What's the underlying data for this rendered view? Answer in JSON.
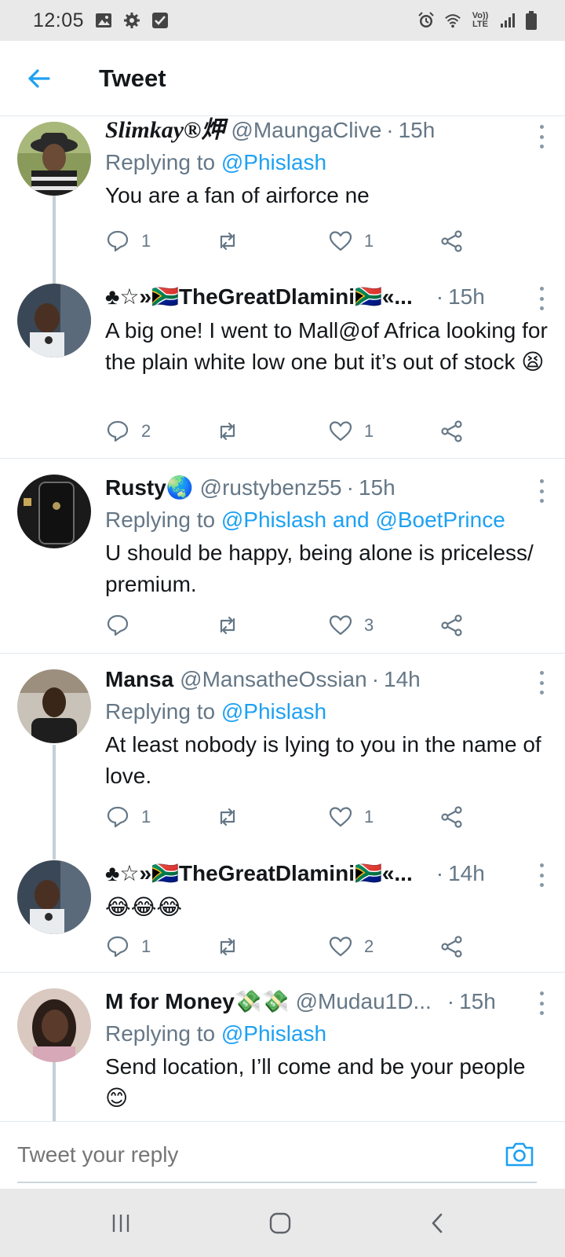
{
  "status_bar": {
    "time": "12:05",
    "left_icons": [
      "gallery-icon",
      "settings-icon",
      "checkbox-icon"
    ],
    "right_icons": [
      "alarm-icon",
      "wifi-icon",
      "volte-icon",
      "signal-icon",
      "battery-icon"
    ],
    "volte_text": "Vo)) LTE"
  },
  "header": {
    "title": "Tweet",
    "back_icon": "arrow-left-icon",
    "accent": "#1da1f2"
  },
  "tweets": [
    {
      "name": "Slimkay®炠",
      "handle": "@MaungaClive",
      "time": "15h",
      "replying_prefix": "Replying to ",
      "replying_to": "@Phislash",
      "text": "You are a fan of airforce ne",
      "reply_count": "1",
      "like_count": "1"
    },
    {
      "name": "♣☆»🇿🇦TheGreatDlamini🇿🇦«...",
      "handle": "",
      "time": "15h",
      "text": "A big one! I went to Mall@of Africa looking for the plain white low one but it’s out of stock 😫",
      "reply_count": "2",
      "like_count": "1"
    },
    {
      "name": "Rusty🌏",
      "handle": "@rustybenz55",
      "time": "15h",
      "replying_prefix": "Replying to ",
      "replying_to": "@Phislash and @BoetPrince",
      "text": "U should  be happy,  being alone is priceless/ premium.",
      "reply_count": "",
      "like_count": "3"
    },
    {
      "name": "Mansa",
      "handle": "@MansatheOssian",
      "time": "14h",
      "replying_prefix": "Replying to ",
      "replying_to": "@Phislash",
      "text": "At least nobody is lying to you in the name of love.",
      "reply_count": "1",
      "like_count": "1"
    },
    {
      "name": "♣☆»🇿🇦TheGreatDlamini🇿🇦«...",
      "handle": "",
      "time": "14h",
      "text": "😂😂😂",
      "reply_count": "1",
      "like_count": "2"
    },
    {
      "name": "M for Money💸💸",
      "handle": "@Mudau1D...",
      "time": "15h",
      "replying_prefix": "Replying to ",
      "replying_to": "@Phislash",
      "text": "Send location, I’ll come and be your people😊",
      "reply_count": "",
      "like_count": ""
    }
  ],
  "reply_bar": {
    "placeholder": "Tweet your reply",
    "camera_icon": "camera-icon"
  },
  "nav_bar": {
    "icons": [
      "recents-icon",
      "home-icon",
      "back-icon"
    ]
  },
  "time_separator": "·"
}
